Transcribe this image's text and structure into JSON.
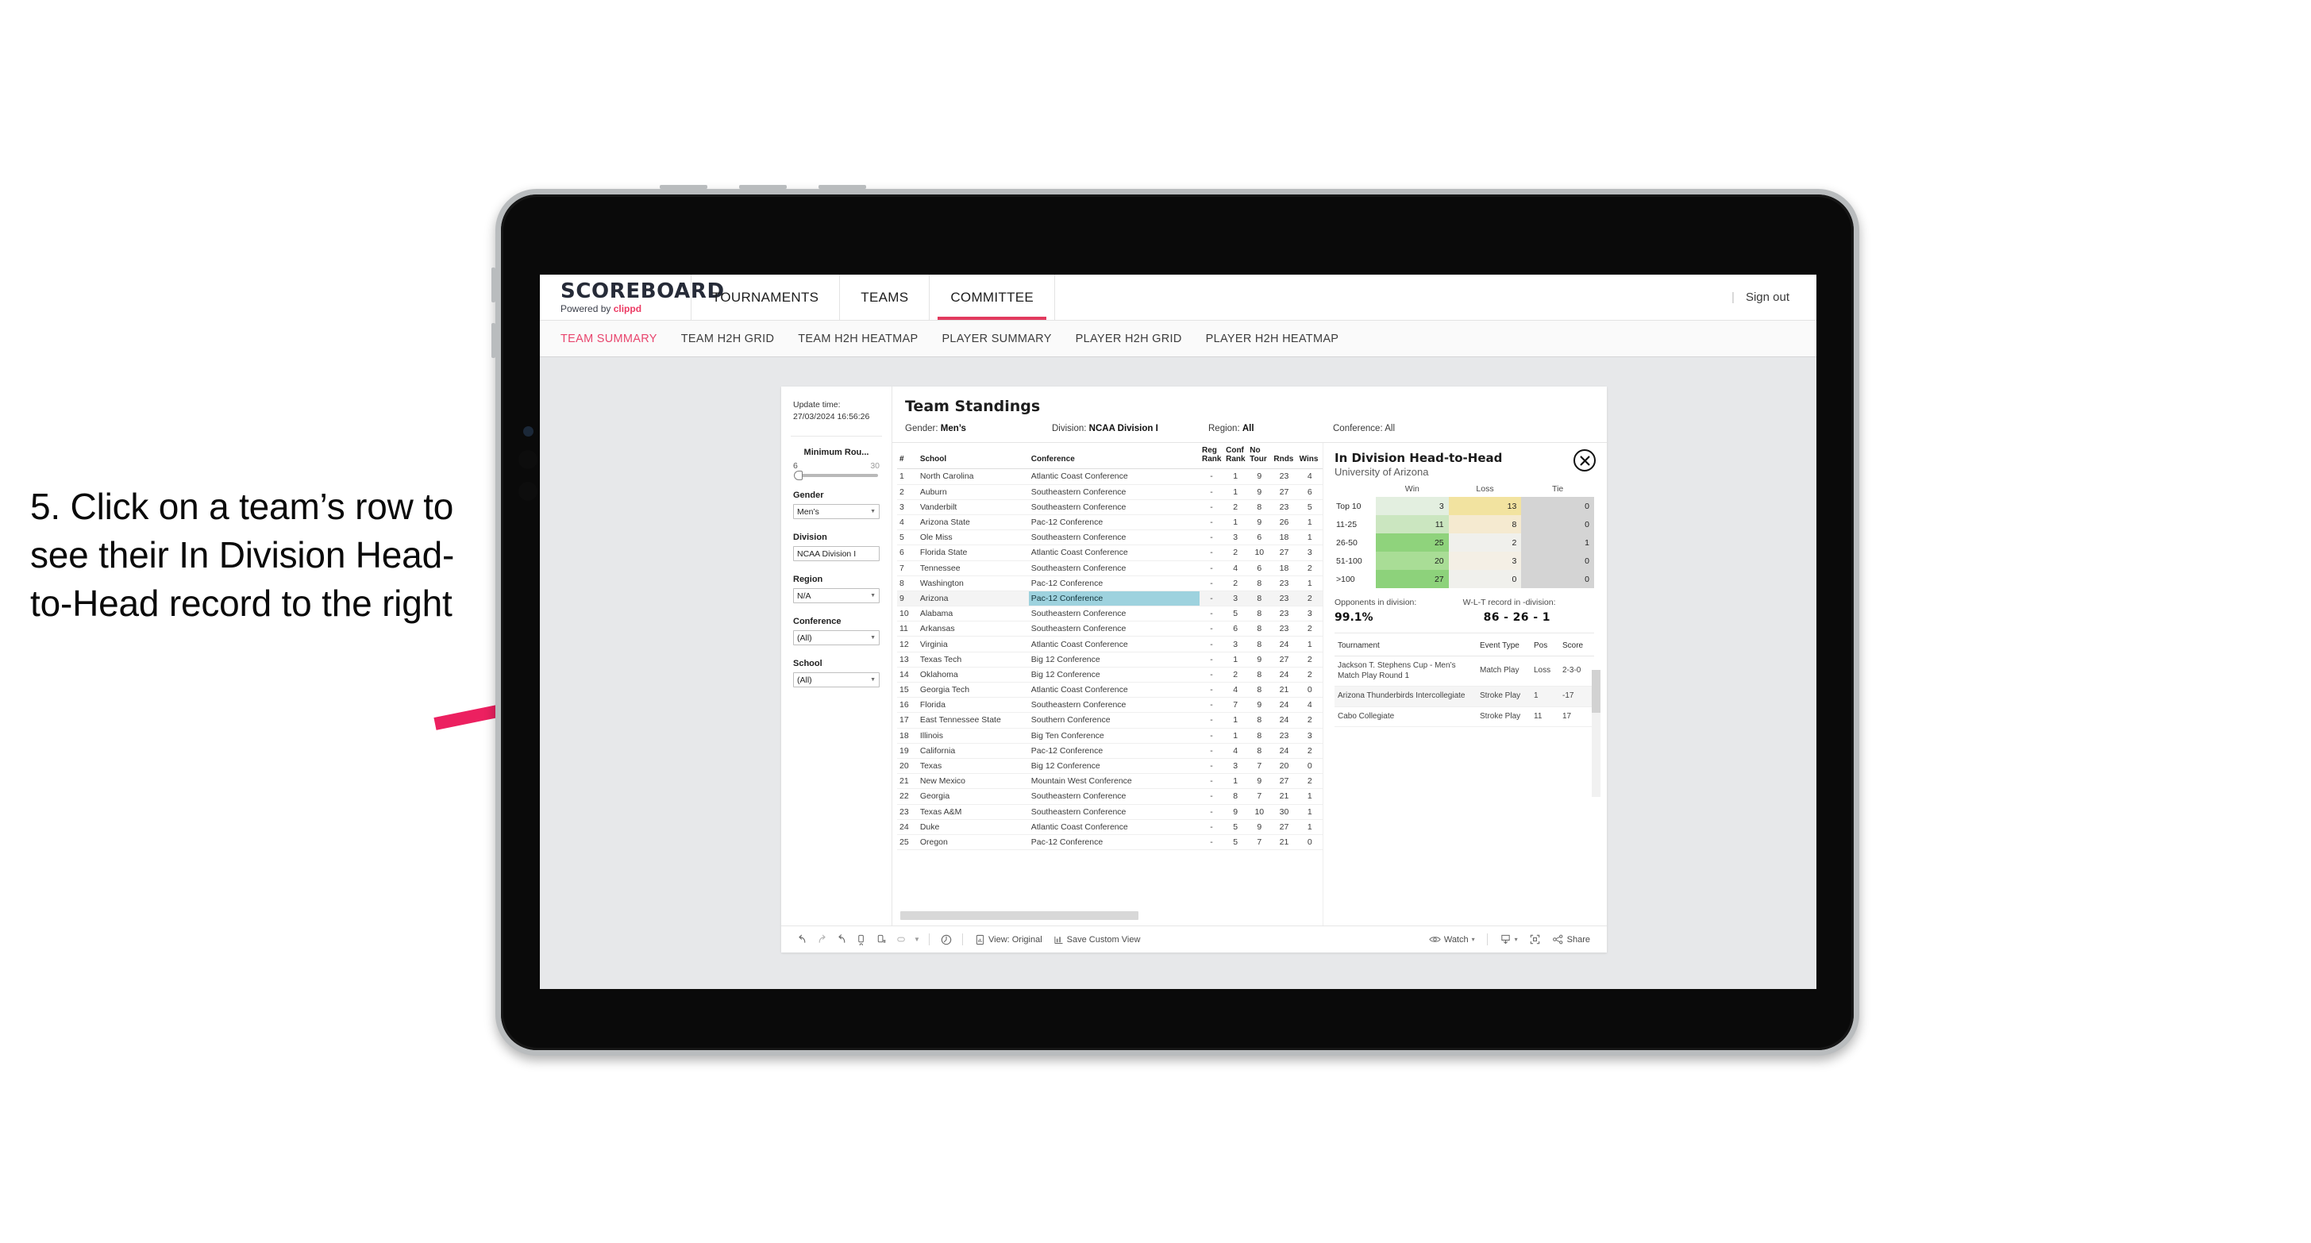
{
  "annotation": {
    "text": "5. Click on a team’s row to see their In Division Head-to-Head record to the right",
    "arrow_color": "#EC2060"
  },
  "header": {
    "brand_name": "SCOREBOARD",
    "brand_sub_prefix": "Powered by ",
    "brand_sub_accent": "clippd",
    "nav": [
      {
        "label": "TOURNAMENTS",
        "active": false
      },
      {
        "label": "TEAMS",
        "active": false
      },
      {
        "label": "COMMITTEE",
        "active": true
      }
    ],
    "sign_out": "Sign out",
    "divider": "|",
    "accent_color": "#E23A5E"
  },
  "subtabs": [
    {
      "label": "TEAM SUMMARY",
      "active": true
    },
    {
      "label": "TEAM H2H GRID",
      "active": false
    },
    {
      "label": "TEAM H2H HEATMAP",
      "active": false
    },
    {
      "label": "PLAYER SUMMARY",
      "active": false
    },
    {
      "label": "PLAYER H2H GRID",
      "active": false
    },
    {
      "label": "PLAYER H2H HEATMAP",
      "active": false
    }
  ],
  "filters": {
    "update_time_label": "Update time:",
    "update_time_value": "27/03/2024 16:56:26",
    "minimum_rounds": {
      "label": "Minimum Rou...",
      "min": "6",
      "max": "30"
    },
    "gender": {
      "label": "Gender",
      "value": "Men’s"
    },
    "division": {
      "label": "Division",
      "value": "NCAA Division I"
    },
    "region": {
      "label": "Region",
      "value": "N/A"
    },
    "conference": {
      "label": "Conference",
      "value": "(All)"
    },
    "school": {
      "label": "School",
      "value": "(All)"
    }
  },
  "standings": {
    "title": "Team Standings",
    "summary": {
      "gender_key": "Gender: ",
      "gender_val": "Men’s",
      "division_key": "Division: ",
      "division_val": "NCAA Division I",
      "region_key": "Region: ",
      "region_val": "All",
      "conference_key": "Conference: ",
      "conference_val": "All"
    },
    "columns": [
      "#",
      "School",
      "Conference",
      "Reg Rank",
      "Conf Rank",
      "No Tour",
      "Rnds",
      "Wins"
    ],
    "column_lines": [
      [
        "#"
      ],
      [
        "School"
      ],
      [
        "Conference"
      ],
      [
        "Reg",
        "Rank"
      ],
      [
        "Conf",
        "Rank"
      ],
      [
        "No",
        "Tour"
      ],
      [
        "Rnds"
      ],
      [
        "Wins"
      ]
    ],
    "rows": [
      {
        "rank": "1",
        "school": "North Carolina",
        "conference": "Atlantic Coast Conference",
        "reg": "-",
        "conf": "1",
        "notour": "9",
        "rnds": "23",
        "wins": "4",
        "selected": false
      },
      {
        "rank": "2",
        "school": "Auburn",
        "conference": "Southeastern Conference",
        "reg": "-",
        "conf": "1",
        "notour": "9",
        "rnds": "27",
        "wins": "6",
        "selected": false
      },
      {
        "rank": "3",
        "school": "Vanderbilt",
        "conference": "Southeastern Conference",
        "reg": "-",
        "conf": "2",
        "notour": "8",
        "rnds": "23",
        "wins": "5",
        "selected": false
      },
      {
        "rank": "4",
        "school": "Arizona State",
        "conference": "Pac-12 Conference",
        "reg": "-",
        "conf": "1",
        "notour": "9",
        "rnds": "26",
        "wins": "1",
        "selected": false
      },
      {
        "rank": "5",
        "school": "Ole Miss",
        "conference": "Southeastern Conference",
        "reg": "-",
        "conf": "3",
        "notour": "6",
        "rnds": "18",
        "wins": "1",
        "selected": false
      },
      {
        "rank": "6",
        "school": "Florida State",
        "conference": "Atlantic Coast Conference",
        "reg": "-",
        "conf": "2",
        "notour": "10",
        "rnds": "27",
        "wins": "3",
        "selected": false
      },
      {
        "rank": "7",
        "school": "Tennessee",
        "conference": "Southeastern Conference",
        "reg": "-",
        "conf": "4",
        "notour": "6",
        "rnds": "18",
        "wins": "2",
        "selected": false
      },
      {
        "rank": "8",
        "school": "Washington",
        "conference": "Pac-12 Conference",
        "reg": "-",
        "conf": "2",
        "notour": "8",
        "rnds": "23",
        "wins": "1",
        "selected": false
      },
      {
        "rank": "9",
        "school": "Arizona",
        "conference": "Pac-12 Conference",
        "reg": "-",
        "conf": "3",
        "notour": "8",
        "rnds": "23",
        "wins": "2",
        "selected": true
      },
      {
        "rank": "10",
        "school": "Alabama",
        "conference": "Southeastern Conference",
        "reg": "-",
        "conf": "5",
        "notour": "8",
        "rnds": "23",
        "wins": "3",
        "selected": false
      },
      {
        "rank": "11",
        "school": "Arkansas",
        "conference": "Southeastern Conference",
        "reg": "-",
        "conf": "6",
        "notour": "8",
        "rnds": "23",
        "wins": "2",
        "selected": false
      },
      {
        "rank": "12",
        "school": "Virginia",
        "conference": "Atlantic Coast Conference",
        "reg": "-",
        "conf": "3",
        "notour": "8",
        "rnds": "24",
        "wins": "1",
        "selected": false
      },
      {
        "rank": "13",
        "school": "Texas Tech",
        "conference": "Big 12 Conference",
        "reg": "-",
        "conf": "1",
        "notour": "9",
        "rnds": "27",
        "wins": "2",
        "selected": false
      },
      {
        "rank": "14",
        "school": "Oklahoma",
        "conference": "Big 12 Conference",
        "reg": "-",
        "conf": "2",
        "notour": "8",
        "rnds": "24",
        "wins": "2",
        "selected": false
      },
      {
        "rank": "15",
        "school": "Georgia Tech",
        "conference": "Atlantic Coast Conference",
        "reg": "-",
        "conf": "4",
        "notour": "8",
        "rnds": "21",
        "wins": "0",
        "selected": false
      },
      {
        "rank": "16",
        "school": "Florida",
        "conference": "Southeastern Conference",
        "reg": "-",
        "conf": "7",
        "notour": "9",
        "rnds": "24",
        "wins": "4",
        "selected": false
      },
      {
        "rank": "17",
        "school": "East Tennessee State",
        "conference": "Southern Conference",
        "reg": "-",
        "conf": "1",
        "notour": "8",
        "rnds": "24",
        "wins": "2",
        "selected": false
      },
      {
        "rank": "18",
        "school": "Illinois",
        "conference": "Big Ten Conference",
        "reg": "-",
        "conf": "1",
        "notour": "8",
        "rnds": "23",
        "wins": "3",
        "selected": false
      },
      {
        "rank": "19",
        "school": "California",
        "conference": "Pac-12 Conference",
        "reg": "-",
        "conf": "4",
        "notour": "8",
        "rnds": "24",
        "wins": "2",
        "selected": false
      },
      {
        "rank": "20",
        "school": "Texas",
        "conference": "Big 12 Conference",
        "reg": "-",
        "conf": "3",
        "notour": "7",
        "rnds": "20",
        "wins": "0",
        "selected": false
      },
      {
        "rank": "21",
        "school": "New Mexico",
        "conference": "Mountain West Conference",
        "reg": "-",
        "conf": "1",
        "notour": "9",
        "rnds": "27",
        "wins": "2",
        "selected": false
      },
      {
        "rank": "22",
        "school": "Georgia",
        "conference": "Southeastern Conference",
        "reg": "-",
        "conf": "8",
        "notour": "7",
        "rnds": "21",
        "wins": "1",
        "selected": false
      },
      {
        "rank": "23",
        "school": "Texas A&M",
        "conference": "Southeastern Conference",
        "reg": "-",
        "conf": "9",
        "notour": "10",
        "rnds": "30",
        "wins": "1",
        "selected": false
      },
      {
        "rank": "24",
        "school": "Duke",
        "conference": "Atlantic Coast Conference",
        "reg": "-",
        "conf": "5",
        "notour": "9",
        "rnds": "27",
        "wins": "1",
        "selected": false
      },
      {
        "rank": "25",
        "school": "Oregon",
        "conference": "Pac-12 Conference",
        "reg": "-",
        "conf": "5",
        "notour": "7",
        "rnds": "21",
        "wins": "0",
        "selected": false
      }
    ]
  },
  "detail": {
    "title": "In Division Head-to-Head",
    "subtitle": "University of Arizona",
    "close_icon": "close-icon",
    "h2h_columns": [
      "",
      "Win",
      "Loss",
      "Tie"
    ],
    "h2h_rows": [
      {
        "label": "Top 10",
        "win": "3",
        "loss": "13",
        "tie": "0",
        "win_color": "#e3efe0",
        "loss_color": "#f2e3a0",
        "tie_color": "#d4d4d4"
      },
      {
        "label": "11-25",
        "win": "11",
        "loss": "8",
        "tie": "0",
        "win_color": "#cbe6c0",
        "loss_color": "#f5ead0",
        "tie_color": "#d4d4d4"
      },
      {
        "label": "26-50",
        "win": "25",
        "loss": "2",
        "tie": "1",
        "win_color": "#8fd37c",
        "loss_color": "#f0f0ec",
        "tie_color": "#d4d4d4"
      },
      {
        "label": "51-100",
        "win": "20",
        "loss": "3",
        "tie": "0",
        "win_color": "#a9dd96",
        "loss_color": "#f4efe5",
        "tie_color": "#d4d4d4"
      },
      {
        "label": ">100",
        "win": "27",
        "loss": "0",
        "tie": "0",
        "win_color": "#8dd27b",
        "loss_color": "#f0f0ec",
        "tie_color": "#d4d4d4"
      }
    ],
    "stats": {
      "opponents_label": "Opponents in division:",
      "opponents_value": "99.1%",
      "record_label": "W-L-T record in -division:",
      "record_value": "86 - 26 - 1"
    },
    "tournament_columns": [
      "Tournament",
      "Event Type",
      "Pos",
      "Score"
    ],
    "tournaments": [
      {
        "name": "Jackson T. Stephens Cup - Men’s Match Play Round 1",
        "event_type": "Match Play",
        "pos": "Loss",
        "score": "2-3-0"
      },
      {
        "name": "Arizona Thunderbirds Intercollegiate",
        "event_type": "Stroke Play",
        "pos": "1",
        "score": "-17"
      },
      {
        "name": "Cabo Collegiate",
        "event_type": "Stroke Play",
        "pos": "11",
        "score": "17"
      }
    ]
  },
  "toolbar": {
    "icons": [
      "undo-icon",
      "redo-icon",
      "revert-icon",
      "refresh-data-icon",
      "pause-refresh-icon",
      "highlight-icon",
      "highlight-dropdown-caret"
    ],
    "alert_icon": "alert-clock-icon",
    "view_label": "View: Original",
    "view_icon": "view-original-icon",
    "save_label": "Save Custom View",
    "save_icon": "save-view-icon",
    "watch_label": "Watch",
    "watch_icon": "eye-icon",
    "watch_caret": "▾",
    "download_icon": "download-icon",
    "download_caret": "▾",
    "fullscreen_icon": "fullscreen-icon",
    "share_label": "Share",
    "share_icon": "share-icon",
    "separator": "|"
  }
}
